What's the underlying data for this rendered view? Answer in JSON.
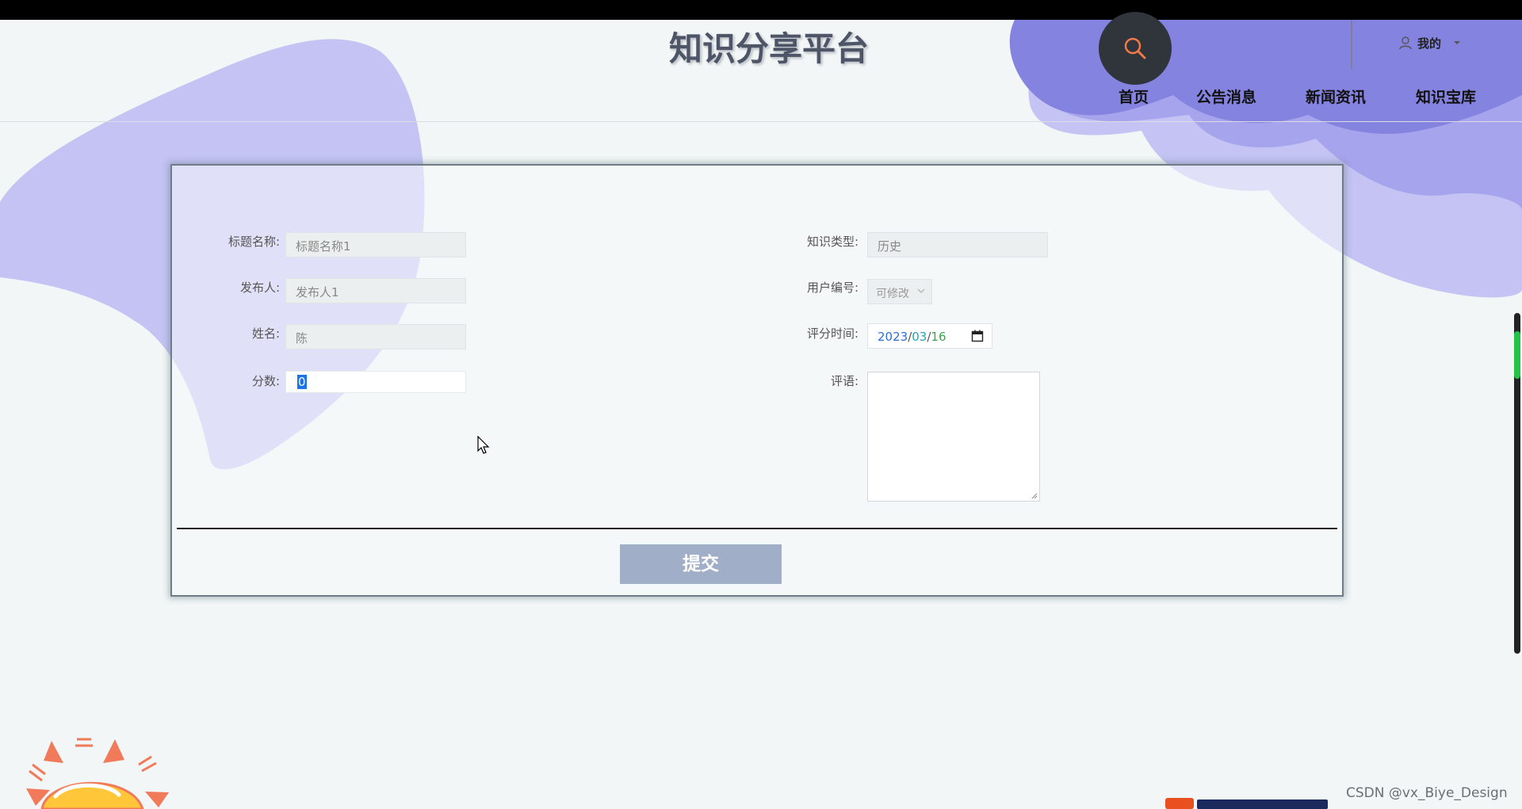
{
  "header": {
    "site_title": "知识分享平台",
    "user_menu_label": "我的",
    "nav_items": [
      "首页",
      "公告消息",
      "新闻资讯",
      "知识宝库"
    ]
  },
  "form": {
    "title_name": {
      "label": "标题名称:",
      "value": "标题名称1"
    },
    "publisher": {
      "label": "发布人:",
      "value": "发布人1"
    },
    "name": {
      "label": "姓名:",
      "value": "陈"
    },
    "score": {
      "label": "分数:",
      "value": "0"
    },
    "knowledge_type": {
      "label": "知识类型:",
      "value": "历史"
    },
    "user_id": {
      "label": "用户编号:",
      "value": "可修改"
    },
    "score_time": {
      "label": "评分时间:",
      "year": "2023",
      "month": "03",
      "day": "16",
      "separator": "/"
    },
    "comment": {
      "label": "评语:",
      "value": ""
    },
    "submit_label": "提交"
  },
  "colors": {
    "accent_purple": "#8583e0",
    "light_purple": "#c4c3f4",
    "submit_bg": "#a1aec7",
    "search_bg": "#30343b",
    "search_icon": "#f07a4a"
  },
  "watermark": "CSDN @vx_Biye_Design"
}
